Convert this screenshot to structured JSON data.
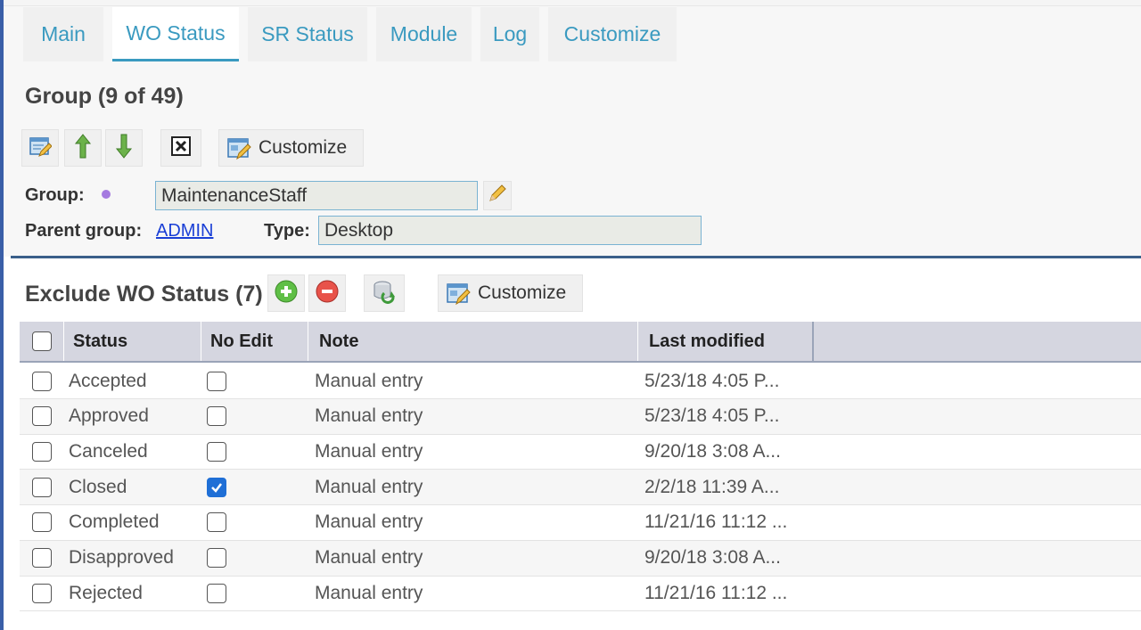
{
  "tabs": [
    "Main",
    "WO Status",
    "SR Status",
    "Module",
    "Log",
    "Customize"
  ],
  "group_section": {
    "title": "Group (9 of 49)",
    "customize_label": "Customize",
    "group_label": "Group:",
    "group_value": "MaintenanceStaff",
    "parent_label": "Parent group:",
    "parent_value": "ADMIN",
    "type_label": "Type:",
    "type_value": "Desktop"
  },
  "exclude_section": {
    "title": "Exclude WO Status (7)",
    "customize_label": "Customize"
  },
  "table": {
    "headers": [
      "Status",
      "No Edit",
      "Note",
      "Last modified"
    ],
    "rows": [
      {
        "status": "Accepted",
        "no_edit": false,
        "note": "Manual entry",
        "modified": "5/23/18 4:05 P..."
      },
      {
        "status": "Approved",
        "no_edit": false,
        "note": "Manual entry",
        "modified": "5/23/18 4:05 P..."
      },
      {
        "status": "Canceled",
        "no_edit": false,
        "note": "Manual entry",
        "modified": "9/20/18 3:08 A..."
      },
      {
        "status": "Closed",
        "no_edit": true,
        "note": "Manual entry",
        "modified": "2/2/18 11:39 A..."
      },
      {
        "status": "Completed",
        "no_edit": false,
        "note": "Manual entry",
        "modified": "11/21/16 11:12 ..."
      },
      {
        "status": "Disapproved",
        "no_edit": false,
        "note": "Manual entry",
        "modified": "9/20/18 3:08 A..."
      },
      {
        "status": "Rejected",
        "no_edit": false,
        "note": "Manual entry",
        "modified": "11/21/16 11:12 ..."
      }
    ]
  },
  "icons": {
    "edit_record": "edit-record-icon",
    "move_up": "arrow-up-icon",
    "move_down": "arrow-down-icon",
    "delete": "delete-box-icon",
    "customize": "customize-icon",
    "group_dot": "purple-dot-icon",
    "pencil": "pencil-icon",
    "add": "add-circle-icon",
    "remove": "remove-circle-icon",
    "refresh": "refresh-stack-icon",
    "checkmark": "checkmark-icon"
  },
  "colors": {
    "accent": "#3a9ac0",
    "checked": "#1f6fd6",
    "header_bg": "#d5d6e0",
    "divider": "#3a5f8a"
  }
}
